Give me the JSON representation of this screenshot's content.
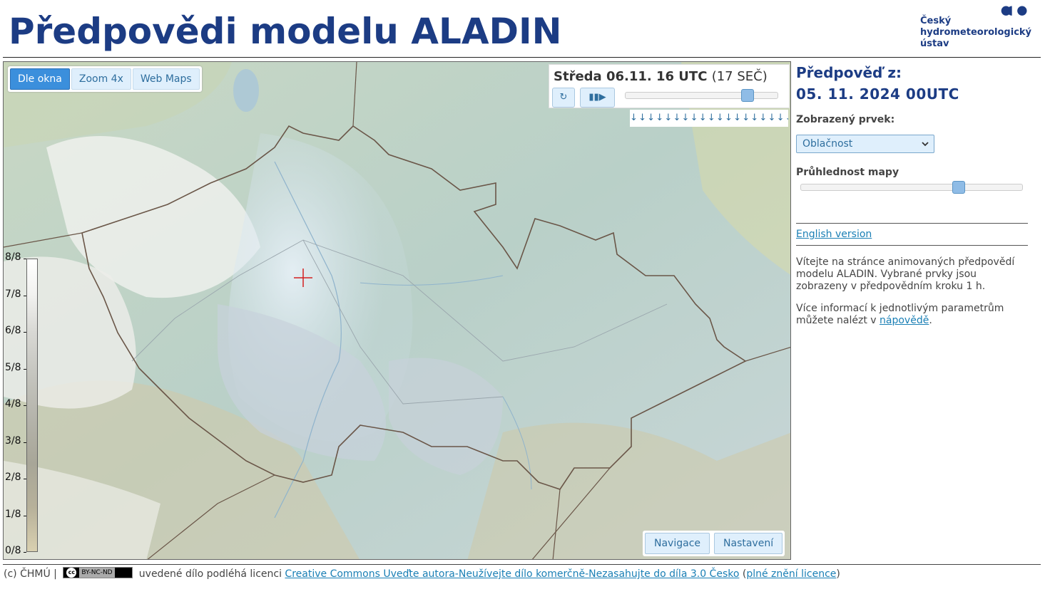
{
  "page": {
    "title": "Předpovědi modelu ALADIN"
  },
  "logo": {
    "line1": "Český",
    "line2": "hydrometeorologický",
    "line3": "ústav",
    "color": "#1c3c84"
  },
  "map_controls": {
    "view_buttons": [
      {
        "label": "Dle okna",
        "active": true
      },
      {
        "label": "Zoom 4x",
        "active": false
      },
      {
        "label": "Web Maps",
        "active": false
      }
    ],
    "player": {
      "time_main": "Středa 06.11. 16 UTC",
      "time_sub": "(17 SEČ)",
      "refresh_icon": "refresh-icon",
      "play_label": "▮▮▶",
      "timeline_position_fraction": 0.8,
      "arrows": "↓↓↓↓↓↓↓↓↓↓↓↓↓↓↓↓↓↓↓↓↓"
    },
    "nav_buttons": {
      "navigation": "Navigace",
      "settings": "Nastavení"
    }
  },
  "legend": {
    "labels": [
      "8/8",
      "7/8",
      "6/8",
      "5/8",
      "4/8",
      "3/8",
      "2/8",
      "1/8",
      "0/8"
    ]
  },
  "side": {
    "forecast_label": "Předpověď z:",
    "forecast_date": "05. 11. 2024 00UTC",
    "element_label": "Zobrazený prvek:",
    "element_value": "Oblačnost",
    "opacity_label": "Průhlednost mapy",
    "opacity_fraction": 0.71,
    "english_link": "English version",
    "intro": "Vítejte na stránce animovaných předpovědí modelu ALADIN. Vybrané prvky jsou zobrazeny v předpovědním kroku 1 h.",
    "more_prefix": "Více informací k jednotlivým parametrům můžete nalézt v ",
    "more_link": "nápovědě",
    "more_suffix": "."
  },
  "footer": {
    "copyright": "(c) ČHMÚ |",
    "badge": "BY-NC-ND",
    "text1": "uvedené dílo podléhá licenci",
    "license_link": "Creative Commons Uveďte autora-Neužívejte dílo komerčně-Nezasahujte do díla 3.0 Česko",
    "paren_open": "(",
    "full_license_link": "plné znění licence",
    "paren_close": ")"
  }
}
